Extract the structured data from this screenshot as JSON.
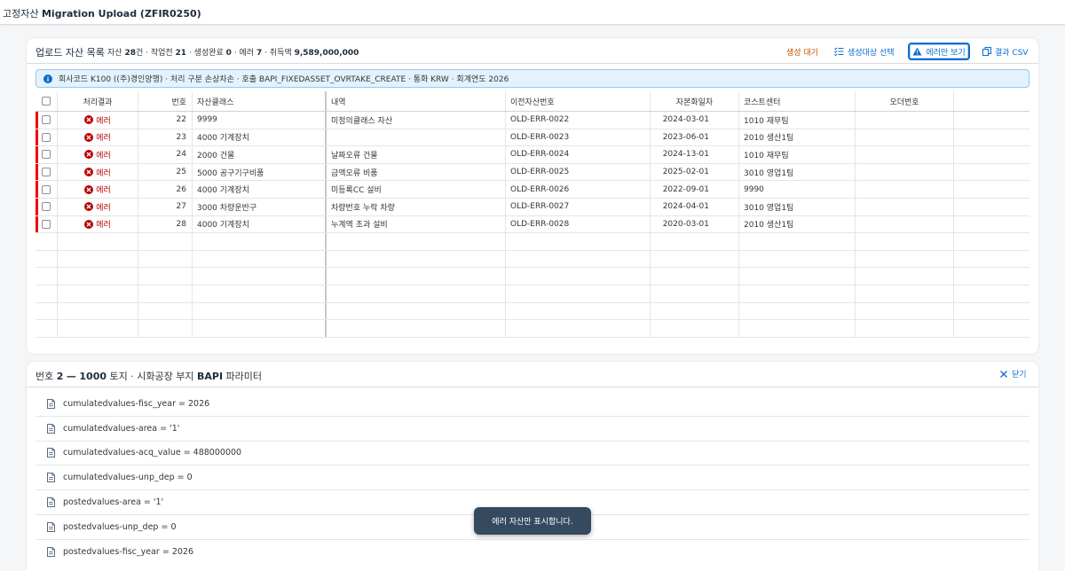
{
  "app": {
    "title_prefix": "고정자산",
    "title_main": "Migration Upload (ZFIR0250)"
  },
  "list_panel": {
    "title": "업로드 자산 목록",
    "stats": {
      "l1": "자산",
      "total": "28",
      "l2": "건 · 작업전",
      "pending": "21",
      "l3": "· 생성완료",
      "done": "0",
      "l4": "· 에러",
      "errors": "7",
      "l5": "· 취득액",
      "amount": "9,589,000,000"
    },
    "toolbar": {
      "pending_label": "생성 대기",
      "select_label": "생성대상 선택",
      "errors_only_label": "에러만 보기",
      "csv_label": "결과 CSV"
    },
    "info": "회사코드 K100 ((주)경인양행) · 처리 구분 손상차손 · 호출 BAPI_FIXEDASSET_OVRTAKE_CREATE · 통화 KRW · 회계연도 2026",
    "columns": {
      "result": "처리결과",
      "num": "번호",
      "class": "자산클래스",
      "desc": "내역",
      "old": "이전자산번호",
      "cap": "자본화일자",
      "cc": "코스트센터",
      "order": "오더번호"
    },
    "rows": [
      {
        "result": "에러",
        "num": "22",
        "class": "9999",
        "desc": "미정의클래스 자산",
        "old": "OLD-ERR-0022",
        "cap": "2024-03-01",
        "cc": "1010 재무팀",
        "order": ""
      },
      {
        "result": "에러",
        "num": "23",
        "class": "4000 기계장치",
        "desc": "",
        "old": "OLD-ERR-0023",
        "cap": "2023-06-01",
        "cc": "2010 생산1팀",
        "order": ""
      },
      {
        "result": "에러",
        "num": "24",
        "class": "2000 건물",
        "desc": "날짜오류 건물",
        "old": "OLD-ERR-0024",
        "cap": "2024-13-01",
        "cc": "1010 재무팀",
        "order": ""
      },
      {
        "result": "에러",
        "num": "25",
        "class": "5000 공구기구비품",
        "desc": "금액오류 비품",
        "old": "OLD-ERR-0025",
        "cap": "2025-02-01",
        "cc": "3010 영업1팀",
        "order": ""
      },
      {
        "result": "에러",
        "num": "26",
        "class": "4000 기계장치",
        "desc": "미등록CC 설비",
        "old": "OLD-ERR-0026",
        "cap": "2022-09-01",
        "cc": "9990",
        "order": ""
      },
      {
        "result": "에러",
        "num": "27",
        "class": "3000 차량운반구",
        "desc": "차량번호 누락 차량",
        "old": "OLD-ERR-0027",
        "cap": "2024-04-01",
        "cc": "3010 영업1팀",
        "order": ""
      },
      {
        "result": "에러",
        "num": "28",
        "class": "4000 기계장치",
        "desc": "누계액 초과 설비",
        "old": "OLD-ERR-0028",
        "cap": "2020-03-01",
        "cc": "2010 생산1팀",
        "order": ""
      }
    ]
  },
  "params_panel": {
    "t1": "번호",
    "num": "2",
    "t2": "—",
    "code": "1000",
    "t3": "토지 · 시화공장 부지",
    "t4": "BAPI",
    "t5": "파라미터",
    "close_label": "닫기",
    "params": [
      "cumulatedvalues-fisc_year = 2026",
      "cumulatedvalues-area = '1'",
      "cumulatedvalues-acq_value = 488000000",
      "cumulatedvalues-unp_dep = 0",
      "postedvalues-area = '1'",
      "postedvalues-unp_dep = 0",
      "postedvalues-fisc_year = 2026"
    ]
  },
  "toast": "에러 자산만 표시합니다.",
  "colors": {
    "accent": "#0a6ed1",
    "error": "#bb0000",
    "warning": "#c35500",
    "toast_bg": "#354a5f"
  },
  "icons": {
    "info": "info-icon",
    "error": "error-circle-icon",
    "select": "checklist-icon",
    "warning": "warning-triangle-icon",
    "csv": "copy-document-icon",
    "close": "close-icon",
    "param": "document-icon"
  }
}
